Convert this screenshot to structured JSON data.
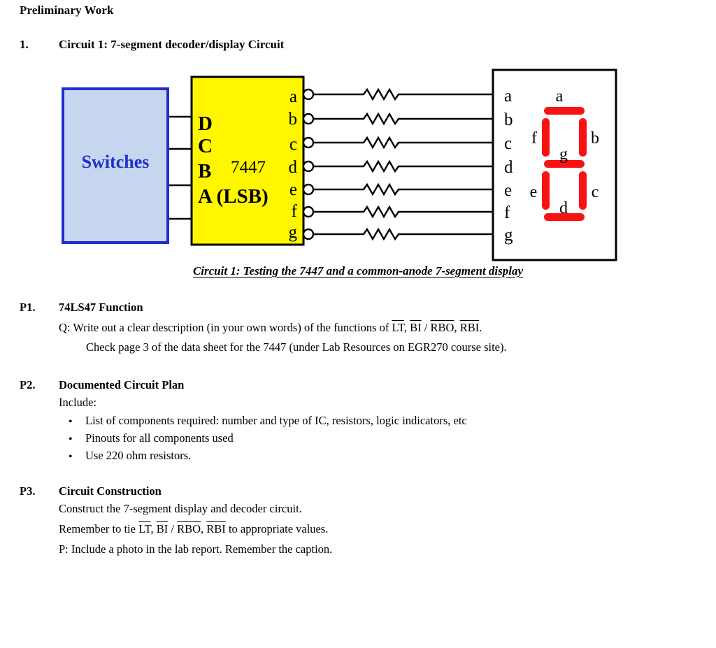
{
  "document": {
    "heading": "Preliminary Work",
    "item1": {
      "number": "1.",
      "title": "Circuit 1:  7-segment decoder/display Circuit"
    }
  },
  "figure": {
    "caption": "Circuit 1:  Testing the 7447 and a common-anode 7-segment display",
    "switches_box": {
      "label": "Switches",
      "fill_color": "#c6d6ee",
      "border_color": "#1f2fd0",
      "text_color": "#1f2fd0"
    },
    "decoder_chip": {
      "part_label": "7447",
      "fill_color": "#fff600",
      "border_color": "#000000",
      "input_labels": [
        "D",
        "C",
        "B",
        "A (LSB)"
      ],
      "output_labels": [
        "a",
        "b",
        "c",
        "d",
        "e",
        "f",
        "g"
      ]
    },
    "resistors": {
      "count": 7,
      "symbol": "zigzag-resistor"
    },
    "display_box": {
      "pin_labels": [
        "a",
        "b",
        "c",
        "d",
        "e",
        "f",
        "g"
      ],
      "segment_labels": {
        "a": "a",
        "b": "b",
        "c": "c",
        "d": "d",
        "e": "e",
        "f": "f",
        "g": "g"
      },
      "segment_color": "#f81313",
      "border_color": "#000000"
    }
  },
  "sections": {
    "p1": {
      "label": "P1.",
      "title": "74LS47 Function",
      "line1_pre": "Q:  Write out a clear description (in your own words) of the functions of ",
      "line1_sig1": "LT",
      "line1_mid1": ",  ",
      "line1_sig2": "BI",
      "line1_mid2": " / ",
      "line1_sig3": "RBO",
      "line1_mid3": ",  ",
      "line1_sig4": "RBI",
      "line1_end": ".",
      "line2": "Check page 3 of the data sheet for the 7447 (under Lab Resources on EGR270 course site)."
    },
    "p2": {
      "label": "P2.",
      "title": "Documented Circuit Plan",
      "intro": "Include:",
      "bullets": [
        "List of components required: number and type of IC, resistors, logic indicators, etc",
        "Pinouts for all components used",
        "Use 220 ohm resistors."
      ],
      "bullet_glyph": "•"
    },
    "p3": {
      "label": "P3.",
      "title": "Circuit Construction",
      "line1": "Construct the 7-segment display and decoder circuit.",
      "line2_pre": "Remember to tie ",
      "line2_sig1": "LT",
      "line2_mid1": ",  ",
      "line2_sig2": "BI",
      "line2_mid2": " / ",
      "line2_sig3": "RBO",
      "line2_mid3": ",  ",
      "line2_sig4": "RBI",
      "line2_end": " to appropriate values.",
      "line3": "P:  Include a photo in the lab report.  Remember the caption."
    }
  }
}
